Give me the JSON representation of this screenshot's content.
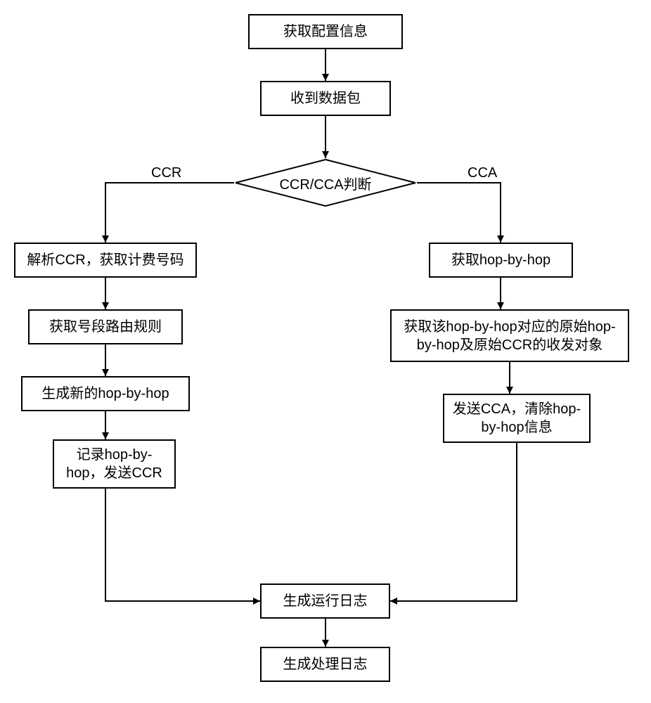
{
  "nodes": {
    "n1": "获取配置信息",
    "n2": "收到数据包",
    "decision": "CCR/CCA判断",
    "left1": "解析CCR，获取计费号码",
    "left2": "获取号段路由规则",
    "left3": "生成新的hop-by-hop",
    "left4": "记录hop-by-hop，发送CCR",
    "right1": "获取hop-by-hop",
    "right2": "获取该hop-by-hop对应的原始hop-by-hop及原始CCR的收发对象",
    "right3": "发送CCA，清除hop-by-hop信息",
    "bottom1": "生成运行日志",
    "bottom2": "生成处理日志"
  },
  "edges": {
    "ccr": "CCR",
    "cca": "CCA"
  }
}
